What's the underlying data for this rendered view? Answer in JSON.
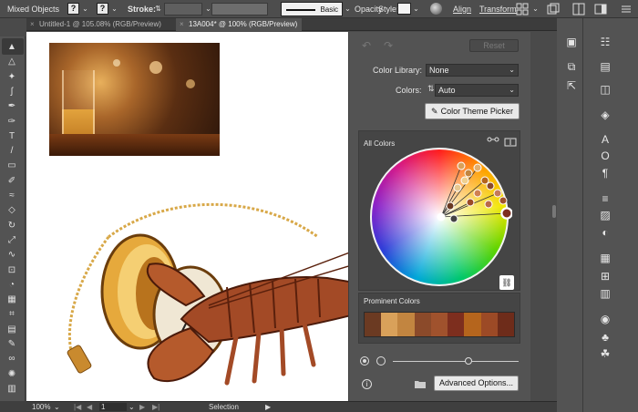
{
  "control_bar": {
    "selection": "Mixed Objects",
    "fill_swatch": "?",
    "stroke_swatch": "?",
    "stroke_label": "Stroke:",
    "brush_profile": "Basic",
    "opacity_label": "Opacity",
    "style_label": "Style:",
    "align_label": "Align",
    "transform_label": "Transform"
  },
  "tabs": [
    {
      "label": "Untitled-1 @ 105.08% (RGB/Preview)",
      "active": false
    },
    {
      "label": "13A004* @ 100% (RGB/Preview)",
      "active": true
    }
  ],
  "tools": [
    "selection-tool-icon",
    "direct-selection-tool-icon",
    "magic-wand-tool-icon",
    "lasso-tool-icon",
    "pen-tool-icon",
    "curvature-tool-icon",
    "type-tool-icon",
    "line-tool-icon",
    "rectangle-tool-icon",
    "paintbrush-tool-icon",
    "shaper-tool-icon",
    "eraser-tool-icon",
    "rotate-tool-icon",
    "scale-tool-icon",
    "warp-tool-icon",
    "free-transform-tool-icon",
    "shape-builder-tool-icon",
    "perspective-grid-tool-icon",
    "mesh-tool-icon",
    "gradient-tool-icon",
    "eyedropper-tool-icon",
    "blend-tool-icon",
    "symbol-sprayer-tool-icon",
    "column-graph-tool-icon"
  ],
  "recolor": {
    "reset_label": "Reset",
    "color_library_label": "Color Library:",
    "color_library_value": "None",
    "colors_label": "Colors:",
    "colors_value": "Auto",
    "theme_picker_label": "Color Theme Picker",
    "all_colors_label": "All Colors",
    "prominent_colors_label": "Prominent Colors",
    "advanced_options_label": "Advanced Options...",
    "prominent_swatches": [
      "#6b3a22",
      "#d9a15a",
      "#c28540",
      "#8b4a2a",
      "#a0522d",
      "#7d2e1e",
      "#b5651d",
      "#9c4a26",
      "#6e2c1a"
    ],
    "saturation": 0.6
  },
  "status": {
    "zoom": "100%",
    "artboard": "1",
    "tool": "Selection"
  }
}
